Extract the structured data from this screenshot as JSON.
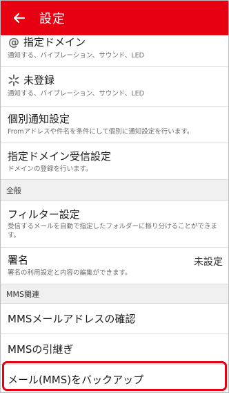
{
  "header": {
    "title": "設定",
    "back_icon": "arrow-left-icon",
    "background": "#e60012"
  },
  "items": {
    "designated_domain": {
      "title": "指定ドメイン",
      "desc": "通知する、バイブレーション、サウンド、LED",
      "icon": "at-icon"
    },
    "unregistered": {
      "title": "未登録",
      "desc": "通知する、バイブレーション、サウンド、LED",
      "icon": "sparkle-icon"
    },
    "individual_notification": {
      "title": "個別通知設定",
      "desc": "Fromアドレスや件名を条件にして個別に通知設定を行います。"
    },
    "domain_reception": {
      "title": "指定ドメイン受信設定",
      "desc": "ドメインの登録を行います。"
    }
  },
  "sections": {
    "general": "全般",
    "mms": "MMS関連"
  },
  "general": {
    "filter": {
      "title": "フィルター設定",
      "desc": "受信するメールを自動で指定したフォルダーに振り分けることができます。"
    },
    "signature": {
      "title": "署名",
      "desc": "署名の利用設定と内容の編集ができます。",
      "value": "未設定"
    }
  },
  "mms": {
    "address_check": {
      "title": "MMSメールアドレスの確認"
    },
    "transfer": {
      "title": "MMSの引継ぎ"
    },
    "backup": {
      "title": "メール(MMS)をバックアップ",
      "highlight_color": "#e60012"
    }
  }
}
